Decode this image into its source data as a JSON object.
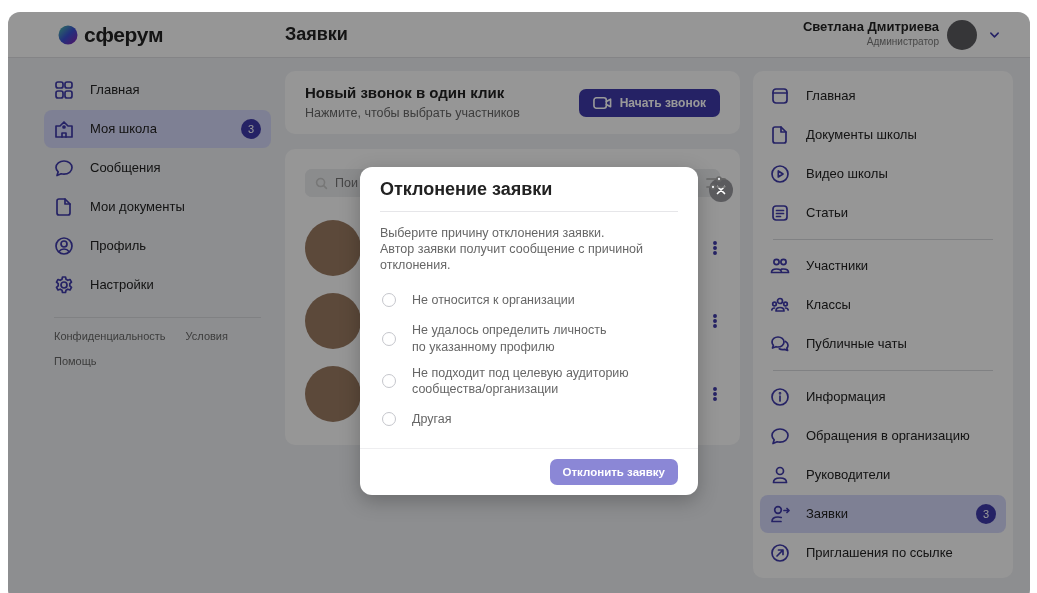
{
  "brand": {
    "name": "сферум"
  },
  "page_title": "Заявки",
  "user": {
    "name": "Светлана Дмитриева",
    "role": "Администратор"
  },
  "sidebar": {
    "items": [
      {
        "label": "Главная",
        "selected": false
      },
      {
        "label": "Моя школа",
        "selected": true,
        "badge": "3"
      },
      {
        "label": "Сообщения",
        "selected": false
      },
      {
        "label": "Мои документы",
        "selected": false
      },
      {
        "label": "Профиль",
        "selected": false
      },
      {
        "label": "Настройки",
        "selected": false
      }
    ],
    "footer_links": [
      "Конфиденциальность",
      "Условия",
      "Помощь"
    ]
  },
  "call_card": {
    "title": "Новый звонок в один клик",
    "subtitle": "Нажмите, чтобы выбрать участников",
    "button": "Начать звонок"
  },
  "requests": {
    "search": {
      "placeholder": "Пои"
    }
  },
  "school_menu": {
    "groups": [
      {
        "items": [
          {
            "label": "Главная",
            "selected": false
          },
          {
            "label": "Документы школы",
            "selected": false
          },
          {
            "label": "Видео школы",
            "selected": false
          },
          {
            "label": "Статьи",
            "selected": false
          }
        ]
      },
      {
        "items": [
          {
            "label": "Участники",
            "selected": false
          },
          {
            "label": "Классы",
            "selected": false
          },
          {
            "label": "Публичные чаты",
            "selected": false
          }
        ]
      },
      {
        "items": [
          {
            "label": "Информация",
            "selected": false
          },
          {
            "label": "Обращения в организацию",
            "selected": false
          },
          {
            "label": "Руководители",
            "selected": false
          },
          {
            "label": "Заявки",
            "selected": true,
            "badge": "3"
          },
          {
            "label": "Приглашения по ссылке",
            "selected": false
          }
        ]
      }
    ]
  },
  "dialog": {
    "title": "Отклонение заявки",
    "description": "Выберите причину отклонения заявки.\nАвтор заявки получит сообщение с причиной отклонения.",
    "options": [
      {
        "label": "Не относится к организации",
        "selected": false
      },
      {
        "label": "Не удалось определить личность\nпо указанному профилю",
        "selected": false
      },
      {
        "label": "Не подходит под целевую аудиторию\nсообщества/организации",
        "selected": false
      },
      {
        "label": "Другая",
        "selected": false
      }
    ],
    "submit": {
      "label": "Отклонить заявку",
      "disabled": true
    }
  }
}
